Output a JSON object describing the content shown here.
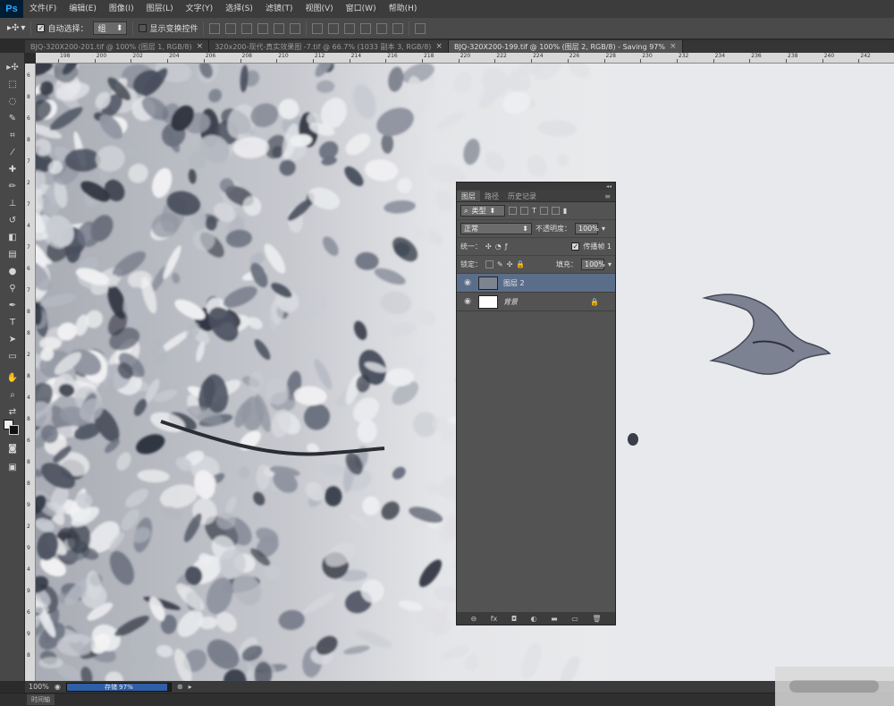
{
  "app": {
    "logo": "Ps",
    "menu": [
      "文件(F)",
      "编辑(E)",
      "图像(I)",
      "图层(L)",
      "文字(Y)",
      "选择(S)",
      "滤镜(T)",
      "视图(V)",
      "窗口(W)",
      "帮助(H)"
    ]
  },
  "options": {
    "auto_select_label": "自动选择：",
    "auto_select_value": "组",
    "show_transform_label": "显示变换控件"
  },
  "tabs": [
    {
      "label": "BJQ-320X200-201.tif @ 100% (图层 1, RGB/8)",
      "close": "×"
    },
    {
      "label": "320x200-现代-真实效果图 -7.tif @ 66.7% (1033 副本 3, RGB/8)",
      "close": "×"
    },
    {
      "label": "BJQ-320X200-199.tif @ 100% (图层 2, RGB/8) - Saving 97%",
      "close": "×"
    }
  ],
  "ruler": {
    "top": [
      "198",
      "200",
      "202",
      "204",
      "206",
      "208",
      "210",
      "212",
      "214",
      "216",
      "218",
      "220",
      "222",
      "224",
      "226",
      "228",
      "230",
      "232",
      "234",
      "236",
      "238",
      "240",
      "242"
    ],
    "left": [
      "6",
      "8",
      "6",
      "8",
      "7",
      "2",
      "7",
      "4",
      "7",
      "6",
      "7",
      "8",
      "8",
      "2",
      "8",
      "4",
      "8",
      "6",
      "8",
      "8",
      "9",
      "2",
      "9",
      "4",
      "9",
      "6",
      "9",
      "8"
    ]
  },
  "layers_panel": {
    "tabs": [
      "图层",
      "路径",
      "历史记录"
    ],
    "filter_kind": "类型",
    "blend_mode": "正常",
    "opacity_label": "不透明度：",
    "opacity_value": "100%",
    "unify_label": "统一：",
    "propagate_label": "传播帧 1",
    "lock_label": "锁定：",
    "fill_label": "填充：",
    "fill_value": "100%",
    "layers": [
      {
        "name": "图层 2",
        "selected": true
      },
      {
        "name": "背景",
        "selected": false,
        "locked": true
      }
    ],
    "bottom_icons": [
      "link-icon",
      "fx-icon",
      "mask-icon",
      "adjustment-icon",
      "folder-icon",
      "new-layer-icon",
      "trash-icon"
    ],
    "bottom_glyphs": [
      "⊖",
      "fx",
      "◘",
      "◐",
      "▬",
      "▭",
      "🗑"
    ]
  },
  "status": {
    "zoom": "100%",
    "progress_label": "存储 97%",
    "progress_value": 0.97
  },
  "timeline": {
    "label": "时间轴"
  }
}
